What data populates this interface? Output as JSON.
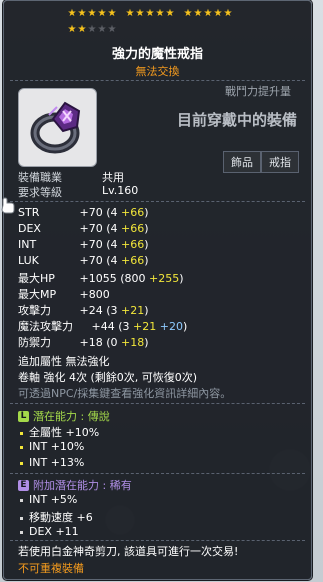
{
  "item": {
    "name": "強力的魔性戒指",
    "trade_status": "無法交換",
    "stars": {
      "filled": 17,
      "total": 20
    },
    "power_label": "戰鬥力提升量",
    "power_value": "目前穿戴中的裝備",
    "categories": [
      "飾品",
      "戒指"
    ],
    "job_label": "裝備職業",
    "job_value": "共用",
    "level_label": "要求等級",
    "level_value": "Lv.160"
  },
  "stats": [
    {
      "name": "STR",
      "total": "+70",
      "base": "(4",
      "bonus": "+66",
      "extra": "",
      "close": ")"
    },
    {
      "name": "DEX",
      "total": "+70",
      "base": "(4",
      "bonus": "+66",
      "extra": "",
      "close": ")"
    },
    {
      "name": "INT",
      "total": "+70",
      "base": "(4",
      "bonus": "+66",
      "extra": "",
      "close": ")"
    },
    {
      "name": "LUK",
      "total": "+70",
      "base": "(4",
      "bonus": "+66",
      "extra": "",
      "close": ")"
    },
    {
      "name": "最大HP",
      "total": "+1055",
      "base": "(800",
      "bonus": "+255",
      "extra": "",
      "close": ")"
    },
    {
      "name": "最大MP",
      "total": "+800",
      "base": "",
      "bonus": "",
      "extra": "",
      "close": ""
    },
    {
      "name": "攻擊力",
      "total": "+24",
      "base": "(3",
      "bonus": "+21",
      "extra": "",
      "close": ")"
    },
    {
      "name": "魔法攻擊力",
      "total": "+44",
      "base": "(3",
      "bonus": "+21",
      "extra": "+20",
      "close": ")"
    },
    {
      "name": "防禦力",
      "total": "+18",
      "base": "(0",
      "bonus": "+18",
      "extra": "",
      "close": ")"
    }
  ],
  "extra_info": {
    "additional_attr": "追加屬性 無法強化",
    "scroll": "卷軸 強化 4次 (剩餘0次, 可恢復0次)",
    "hint": "可透過NPC/採集鍵查看強化資訊詳細內容。"
  },
  "potential": {
    "tag": "L",
    "label": "潛在能力 : 傳說",
    "lines": [
      "全屬性 +10%",
      "INT +10%",
      "INT +13%"
    ]
  },
  "bonus_potential": {
    "tag": "E",
    "label": "附加潛在能力 : 稀有",
    "lines": [
      "INT +5%",
      "移動速度 +6",
      "DEX +11"
    ]
  },
  "footer": {
    "note": "若使用白金神奇剪刀, 該道具可進行一次交易!",
    "warning": "不可重複裝備"
  }
}
